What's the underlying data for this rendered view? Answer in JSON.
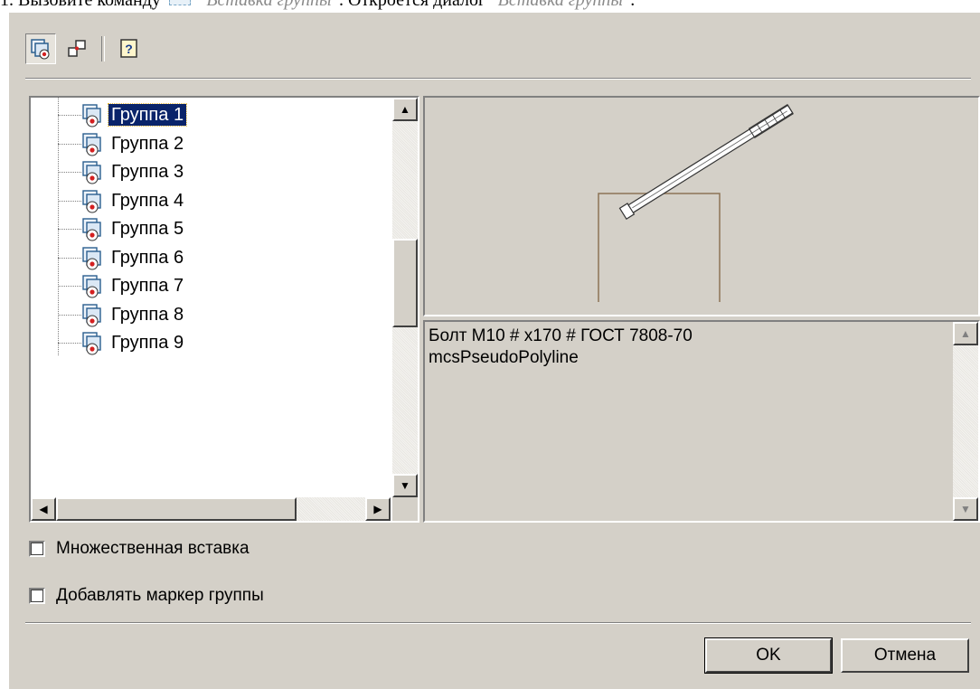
{
  "doc": {
    "prefix": "1. Вызовите команду",
    "command": "\"Вставка группы\"",
    "middle": ". Откроется диалог",
    "dialog_name": "\"Вставка группы\"",
    "suffix": "."
  },
  "toolbar": {
    "buttons": [
      {
        "name": "insert-group-icon",
        "pressed": true
      },
      {
        "name": "group-marker-icon",
        "pressed": false
      },
      {
        "name": "help-icon",
        "pressed": false
      }
    ]
  },
  "tree": {
    "items": [
      "Группа 1",
      "Группа 2",
      "Группа 3",
      "Группа 4",
      "Группа 5",
      "Группа 6",
      "Группа 7",
      "Группа 8",
      "Группа 9"
    ],
    "selected_index": 0
  },
  "description": {
    "text": "Болт М10 # x170 # ГОСТ 7808-70\nmcsPseudoPolyline"
  },
  "options": {
    "multiple_insert": {
      "label": "Множественная вставка",
      "checked": false
    },
    "add_marker": {
      "label": "Добавлять маркер группы",
      "checked": false
    }
  },
  "buttons": {
    "ok": "OK",
    "cancel": "Отмена"
  },
  "colors": {
    "dialog_bg": "#d4d0c8",
    "selection": "#0a246a",
    "preview_line": "#8b7355"
  }
}
